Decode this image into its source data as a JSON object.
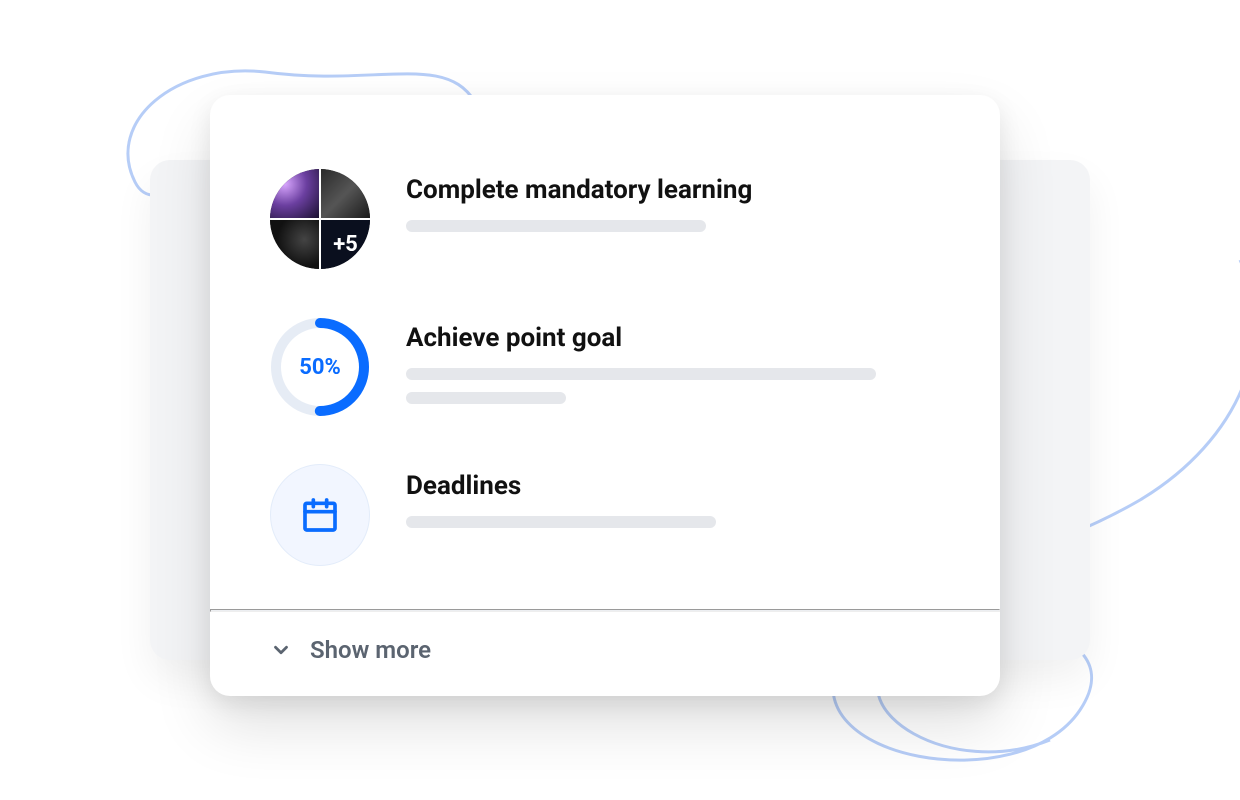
{
  "tasks": {
    "items": [
      {
        "title": "Complete mandatory learning",
        "kind": "stacked_avatars",
        "more_count": "+5",
        "placeholder_lines": [
          300
        ]
      },
      {
        "title": "Achieve point goal",
        "kind": "progress_ring",
        "progress_percent": 50,
        "progress_label": "50%",
        "placeholder_lines": [
          470,
          160
        ]
      },
      {
        "title": "Deadlines",
        "kind": "icon",
        "icon_name": "calendar",
        "placeholder_lines": [
          310
        ]
      }
    ]
  },
  "footer": {
    "show_more_label": "Show more"
  },
  "colors": {
    "accent": "#0a6cff",
    "ring_track": "#e6ecf5",
    "skeleton": "#e5e7eb"
  }
}
